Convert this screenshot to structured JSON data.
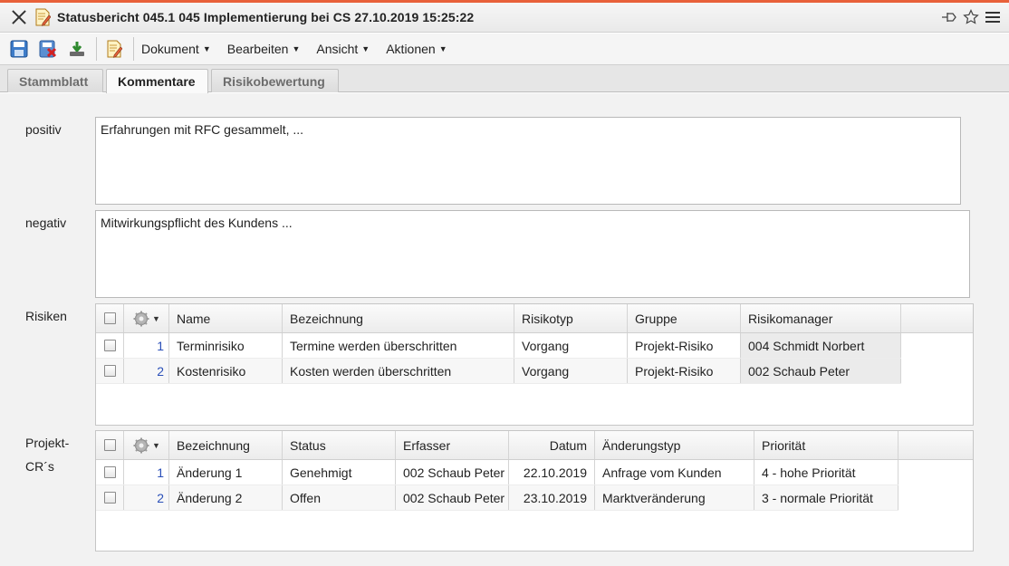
{
  "window": {
    "title": "Statusbericht 045.1 045 Implementierung bei CS 27.10.2019 15:25:22",
    "accent_color": "#e8613a",
    "icons": [
      "close-icon",
      "document-edit-icon",
      "pin-icon",
      "star-icon",
      "hamburger-menu-icon"
    ]
  },
  "toolbar": {
    "icons": [
      "save-icon",
      "delete-icon",
      "download-icon",
      "edit-document-icon"
    ],
    "menus": [
      "Dokument",
      "Bearbeiten",
      "Ansicht",
      "Aktionen"
    ]
  },
  "tabs": [
    {
      "label": "Stammblatt",
      "active": false
    },
    {
      "label": "Kommentare",
      "active": true
    },
    {
      "label": "Risikobewertung",
      "active": false
    }
  ],
  "form": {
    "positiv_label": "positiv",
    "positiv_value": "Erfahrungen mit RFC gesammelt, ...",
    "negativ_label": "negativ",
    "negativ_value": "Mitwirkungspflicht des Kundens ...",
    "risiken_label": "Risiken",
    "projekt_label_line1": "Projekt-",
    "projekt_label_line2": "CR´s"
  },
  "risiken": {
    "columns": [
      "Name",
      "Bezeichnung",
      "Risikotyp",
      "Gruppe",
      "Risikomanager"
    ],
    "rows": [
      {
        "nr": "1",
        "name": "Terminrisiko",
        "bezeichnung": "Termine werden überschritten",
        "risikotyp": "Vorgang",
        "gruppe": "Projekt-Risiko",
        "risikomanager": "004 Schmidt Norbert"
      },
      {
        "nr": "2",
        "name": "Kostenrisiko",
        "bezeichnung": "Kosten werden überschritten",
        "risikotyp": "Vorgang",
        "gruppe": "Projekt-Risiko",
        "risikomanager": "002 Schaub Peter"
      }
    ]
  },
  "crs": {
    "columns": [
      "Bezeichnung",
      "Status",
      "Erfasser",
      "Datum",
      "Änderungstyp",
      "Priorität"
    ],
    "rows": [
      {
        "nr": "1",
        "bezeichnung": "Änderung 1",
        "status": "Genehmigt",
        "erfasser": "002 Schaub Peter",
        "datum": "22.10.2019",
        "aenderungstyp": "Anfrage vom Kunden",
        "prioritaet": "4 - hohe Priorität"
      },
      {
        "nr": "2",
        "bezeichnung": "Änderung 2",
        "status": "Offen",
        "erfasser": "002 Schaub Peter",
        "datum": "23.10.2019",
        "aenderungstyp": "Marktveränderung",
        "prioritaet": "3 - normale Priorität"
      }
    ]
  }
}
